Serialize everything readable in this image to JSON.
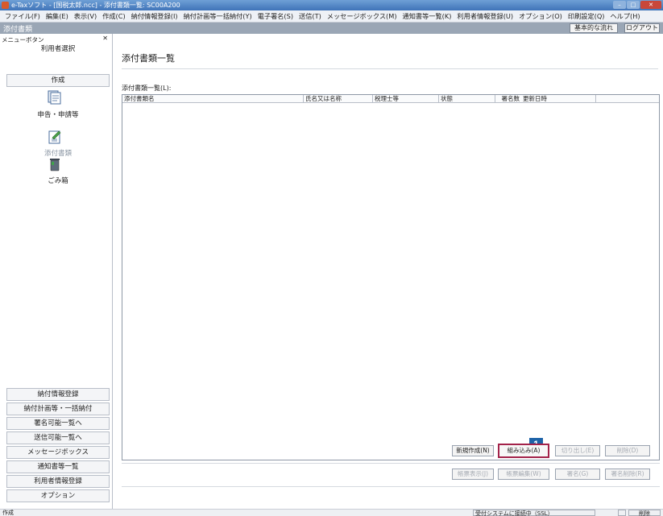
{
  "window": {
    "title": "e-Taxソフト - [国税太郎.ncc] - 添付書類一覧: SC00A200",
    "controls": [
      "–",
      "□",
      "✕"
    ]
  },
  "menubar": [
    "ファイル(F)",
    "編集(E)",
    "表示(V)",
    "作成(C)",
    "納付情報登録(I)",
    "納付計画等一括納付(Y)",
    "電子署名(S)",
    "送信(T)",
    "メッセージボックス(M)",
    "通知書等一覧(K)",
    "利用者情報登録(U)",
    "オプション(O)",
    "印刷設定(Q)",
    "ヘルプ(H)"
  ],
  "header": {
    "title": "添付書類",
    "basic_flow": "基本的な流れ",
    "logout": "ログアウト"
  },
  "sidebar": {
    "menu_label": "メニューボタン",
    "pin": "✕",
    "user_select": "利用者選択",
    "create": "作成",
    "icons": [
      {
        "label": "申告・申請等",
        "icon": "document-stack-icon"
      },
      {
        "label": "添付書類",
        "icon": "pencil-document-icon"
      },
      {
        "label": "ごみ箱",
        "icon": "trash-bin-icon"
      }
    ],
    "bottom_buttons": [
      "納付情報登録",
      "納付計画等・一括納付",
      "署名可能一覧へ",
      "送信可能一覧へ",
      "メッセージボックス",
      "通知書等一覧",
      "利用者情報登録",
      "オプション"
    ]
  },
  "main": {
    "page_title": "添付書類一覧",
    "list_label": "添付書類一覧(L):",
    "columns": [
      "添付書類名",
      "氏名又は名称",
      "税理士等",
      "状態",
      "署名数",
      "更新日時"
    ],
    "row1": {
      "new": "新規作成(N)",
      "import": "組み込み(A)",
      "export": "切り出し(E)",
      "delete": "削除(D)"
    },
    "row2": {
      "view": "帳票表示(J)",
      "edit": "帳票編集(W)",
      "sign": "署名(G)",
      "sign_delete": "署名削除(R)"
    },
    "callout": "1"
  },
  "status": {
    "left": "作成",
    "connection": "受付システムに接続中（SSL）",
    "right": "削除"
  },
  "colors": {
    "accent": "#1e63a8",
    "highlight_border": "#a3224a",
    "titlebar": "#3f73b8",
    "headerbar": "#9aa6b5"
  }
}
